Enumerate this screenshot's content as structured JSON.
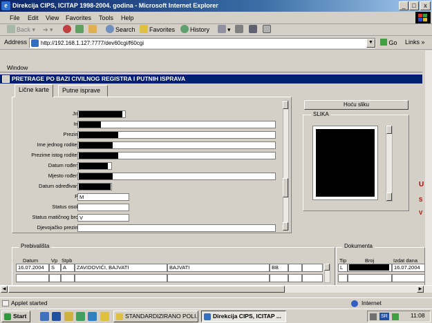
{
  "window": {
    "title": "Direkcija CIPS, ICITAP 1998-2004. godina - Microsoft Internet Explorer",
    "controls": [
      "_",
      "□",
      "x"
    ]
  },
  "menu": [
    "File",
    "Edit",
    "View",
    "Favorites",
    "Tools",
    "Help"
  ],
  "toolbar": {
    "back": "Back",
    "search": "Search",
    "favorites": "Favorites",
    "history": "History"
  },
  "address": {
    "label": "Address",
    "url": "http://192.168.1.127:7777/dev60cgi/f60cgi",
    "go": "Go",
    "links": "Links"
  },
  "applet": {
    "window_label": "Window",
    "title": "PRETRAGE PO BAZI CIVILNOG REGISTRA I PUTNIH ISPRAVA",
    "tabs": [
      "Lične karte",
      "Putne isprave"
    ],
    "fields": [
      {
        "label": "Jmb",
        "value": ""
      },
      {
        "label": "Ime",
        "value": ""
      },
      {
        "label": "Prezime",
        "value": ""
      },
      {
        "label": "Ime jednog roditelja",
        "value": ""
      },
      {
        "label": "Prezime istog roditelja",
        "value": ""
      },
      {
        "label": "Datum rođenja",
        "value": ""
      },
      {
        "label": "Mjesto rođenja",
        "value": ""
      },
      {
        "label": "Datum određivanja",
        "value": ""
      },
      {
        "label": "Pol",
        "value": "M"
      },
      {
        "label": "Status osobe",
        "value": ""
      },
      {
        "label": "Status matičnog broja",
        "value": "V"
      },
      {
        "label": "Djevojačko prezime",
        "value": ""
      }
    ],
    "photo_button": "Hoću sliku",
    "photo_label": "SLIKA",
    "side_letters": [
      "U",
      "S",
      "V"
    ],
    "prebivalista": {
      "title": "Prebivališta",
      "headers": [
        "Datum",
        "Vp",
        "Stpb"
      ],
      "row": [
        "16.07.2004",
        "S",
        "A",
        "ZAVIDOVIĆI, BAJVATI",
        "BAJVATI",
        "BB"
      ]
    },
    "dokumenta": {
      "title": "Dokumenta",
      "headers": [
        "Tip",
        "Broj",
        "Izdat dana"
      ],
      "row": [
        "L",
        "",
        "16.07.2004"
      ]
    }
  },
  "status": {
    "text": "Applet started",
    "zone": "Internet"
  },
  "taskbar": {
    "start": "Start",
    "tasks": [
      "STANDARDIZIRANO POLI...",
      "Direkcija CIPS, ICITAP ..."
    ],
    "tray_lang": "SR",
    "clock": "11:08"
  },
  "colors": {
    "titlebar": "#0a246a",
    "applet_title": "#001f6e",
    "face": "#d4d0c8",
    "accent_red": "#c00000"
  }
}
